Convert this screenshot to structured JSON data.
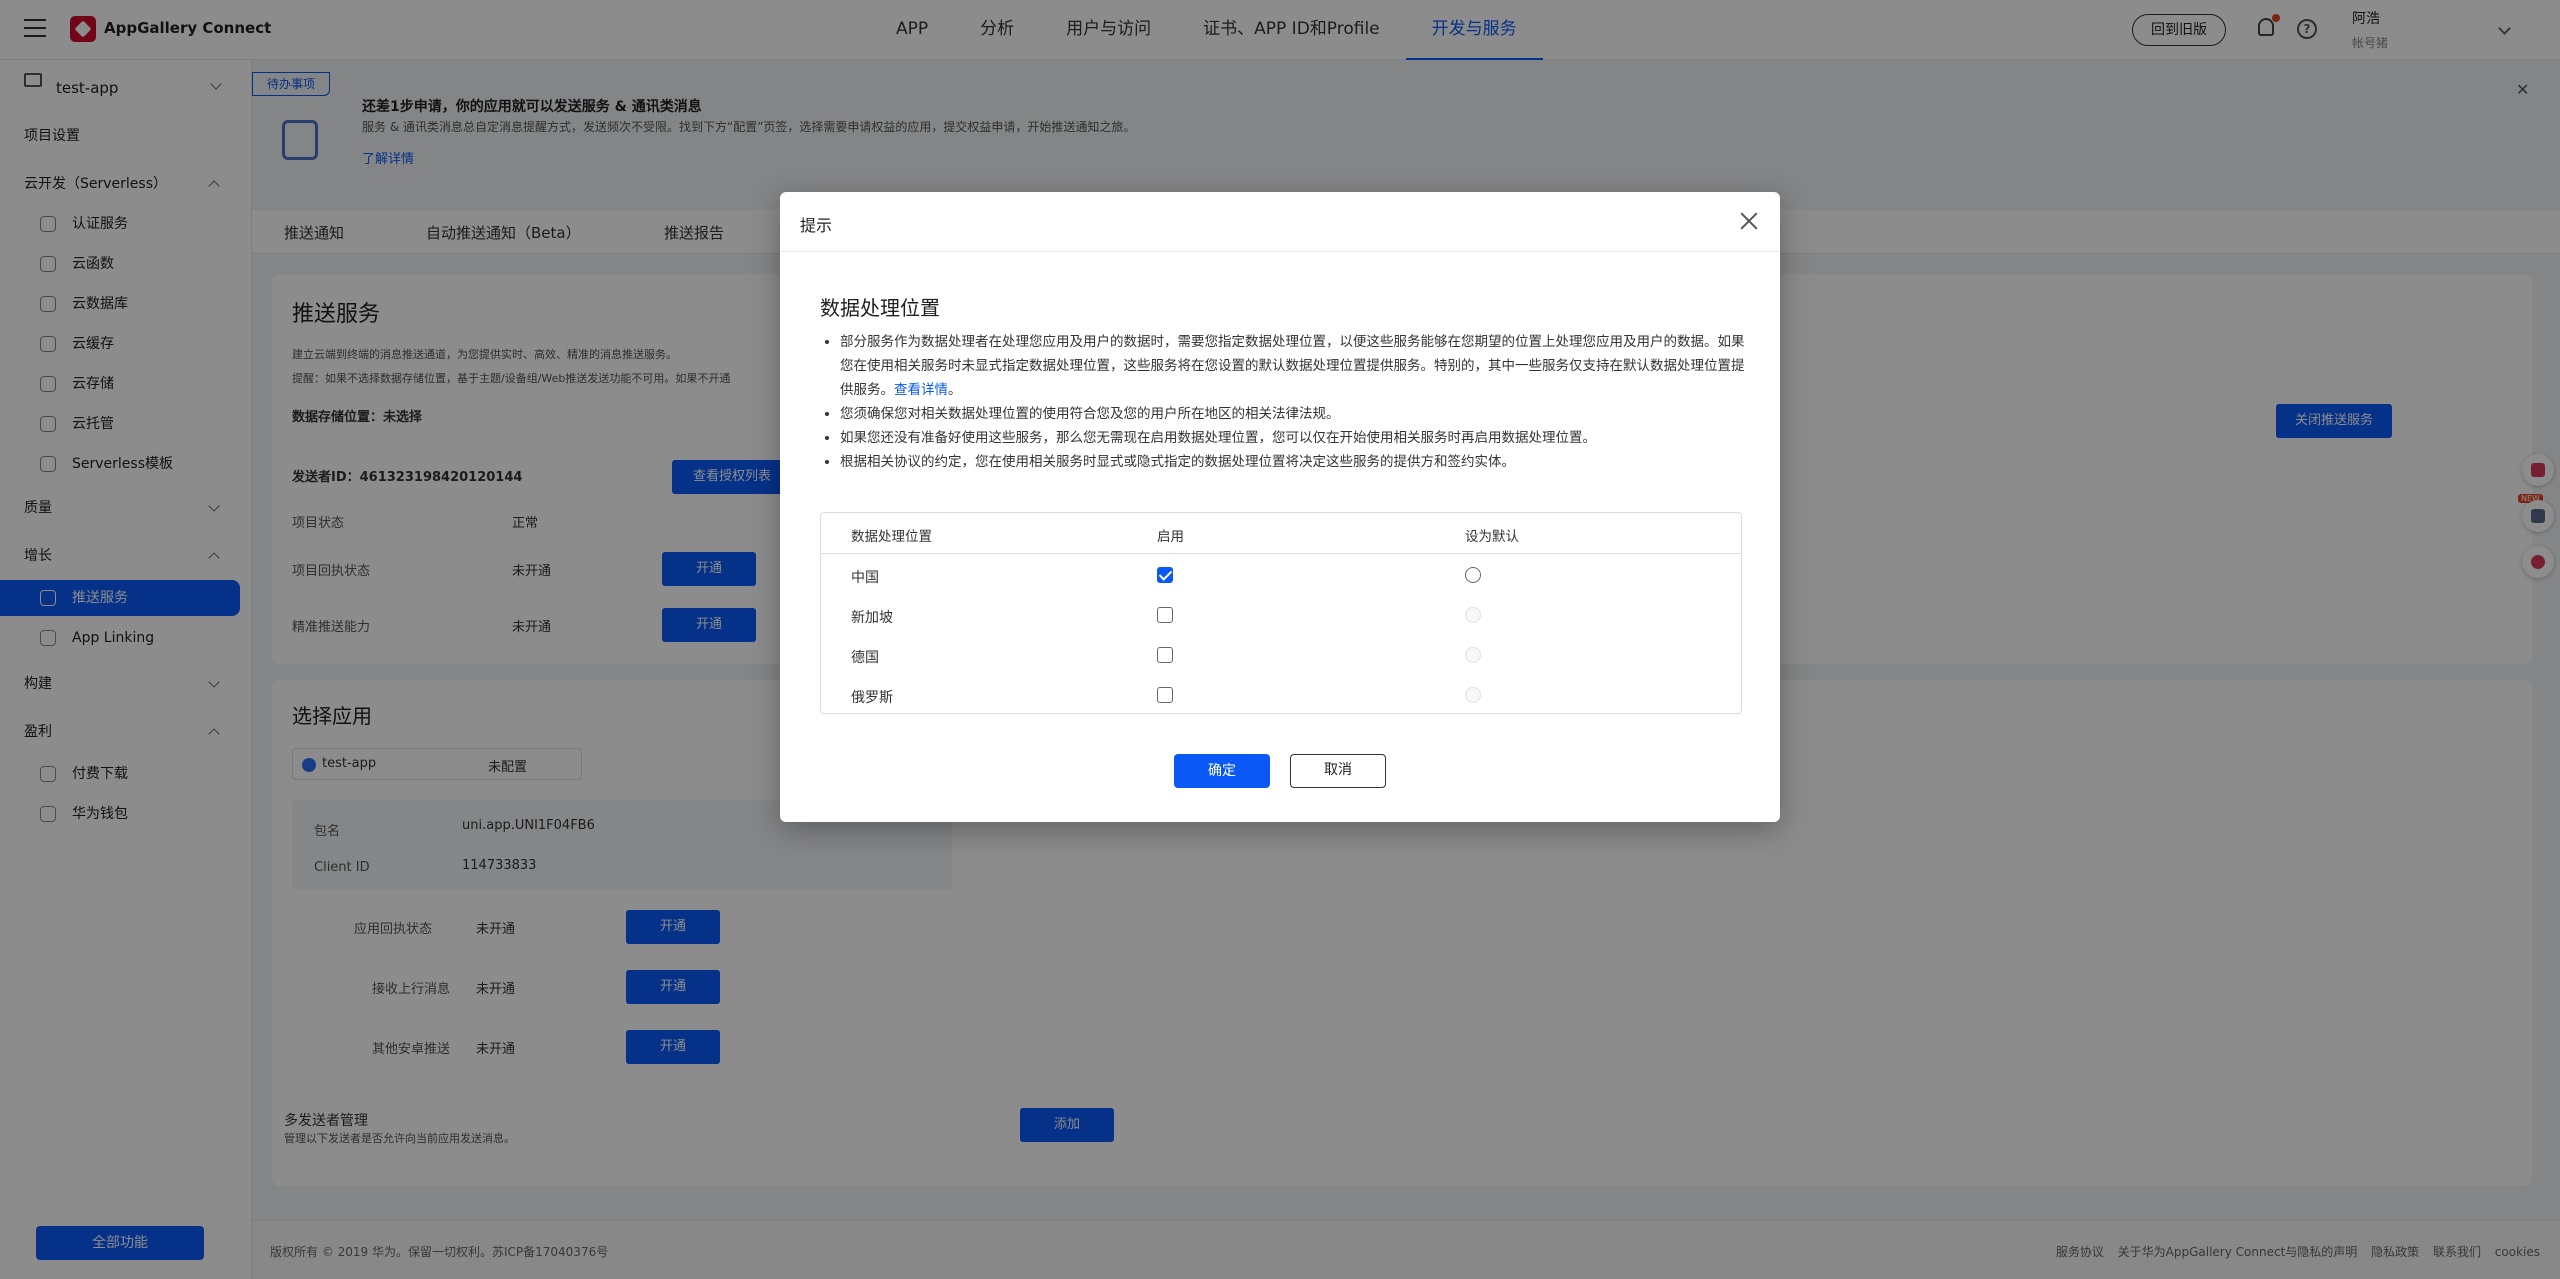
{
  "header": {
    "brand": "AppGallery Connect",
    "nav": [
      "APP",
      "分析",
      "用户与访问",
      "证书、APP ID和Profile",
      "开发与服务"
    ],
    "active_nav": "开发与服务",
    "old_version": "回到旧版",
    "user_name": "阿浩",
    "user_role": "帐号猪"
  },
  "sidebar": {
    "project": "test-app",
    "project_settings": "项目设置",
    "serverless": "云开发（Serverless）",
    "serverless_items": [
      "认证服务",
      "云函数",
      "云数据库",
      "云缓存",
      "云存储",
      "云托管",
      "Serverless模板"
    ],
    "quality": "质量",
    "growth": "增长",
    "growth_items": [
      "推送服务",
      "App Linking"
    ],
    "build": "构建",
    "earn": "盈利",
    "earn_items": [
      "付费下载",
      "华为钱包"
    ],
    "all_functions": "全部功能"
  },
  "background": {
    "todo": "待办事项",
    "banner_title": "还差1步申请，你的应用就可以发送服务 & 通讯类消息",
    "banner_desc": "服务 & 通讯类消息总自定消息提醒方式，发送频次不受限。找到下方“配置”页签，选择需要申请权益的应用，提交权益申请，开始推送通知之旅。",
    "banner_link": "了解详情",
    "tabs": [
      "推送通知",
      "自动推送通知（Beta）",
      "推送报告"
    ],
    "push_title": "推送服务",
    "push_desc1": "建立云端到终端的消息推送通道，为您提供实时、高效、精准的消息推送服务。",
    "push_desc2": "提醒：如果不选择数据存储位置，基于主题/设备组/Web推送发送功能不可用。如果不开通",
    "storage": "数据存储位置：未选择",
    "close_push": "关闭推送服务",
    "sender_id": "发送者ID：461323198420120144",
    "view_auth": "查看授权列表",
    "project_status_label": "项目状态",
    "project_status_value": "正常",
    "receipt_label": "项目回执状态",
    "receipt_value": "未开通",
    "precise_label": "精准推送能力",
    "precise_value": "未开通",
    "open": "开通",
    "select_app": "选择应用",
    "app_name": "test-app",
    "app_config": "未配置",
    "pkg_label": "包名",
    "pkg_value": "uni.app.UNI1F04FB6",
    "client_label": "Client ID",
    "client_value": "114733833",
    "app_receipt_label": "应用回执状态",
    "upstream_label": "接收上行消息",
    "android_label": "其他安卓推送",
    "multi_sender": "多发送者管理",
    "multi_sender_desc": "管理以下发送者是否允许向当前应用发送消息。",
    "add": "添加"
  },
  "footer": {
    "copyright": "版权所有 © 2019 华为。保留一切权利。苏ICP备17040376号",
    "links": [
      "服务协议",
      "关于华为AppGallery Connect与隐私的声明",
      "隐私政策",
      "联系我们",
      "cookies"
    ]
  },
  "float": {
    "new": "NEW"
  },
  "dialog": {
    "title": "提示",
    "section_title": "数据处理位置",
    "bullet1": "部分服务作为数据处理者在处理您应用及用户的数据时，需要您指定数据处理位置，以便这些服务能够在您期望的位置上处理您应用及用户的数据。如果您在使用相关服务时未显式指定数据处理位置，这些服务将在您设置的默认数据处理位置提供服务。特别的，其中一些服务仅支持在默认数据处理位置提供服务。",
    "bullet1_link": "查看详情",
    "bullet2": "您须确保您对相关数据处理位置的使用符合您及您的用户所在地区的相关法律法规。",
    "bullet3": "如果您还没有准备好使用这些服务，那么您无需现在启用数据处理位置，您可以仅在开始使用相关服务时再启用数据处理位置。",
    "bullet4": "根据相关协议的约定，您在使用相关服务时显式或隐式指定的数据处理位置将决定这些服务的提供方和签约实体。",
    "table": {
      "headers": [
        "数据处理位置",
        "启用",
        "设为默认"
      ],
      "rows": [
        {
          "location": "中国",
          "enabled": true,
          "default_enabled": true
        },
        {
          "location": "新加坡",
          "enabled": false,
          "default_enabled": false
        },
        {
          "location": "德国",
          "enabled": false,
          "default_enabled": false
        },
        {
          "location": "俄罗斯",
          "enabled": false,
          "default_enabled": false
        }
      ]
    },
    "ok": "确定",
    "cancel": "取消"
  }
}
